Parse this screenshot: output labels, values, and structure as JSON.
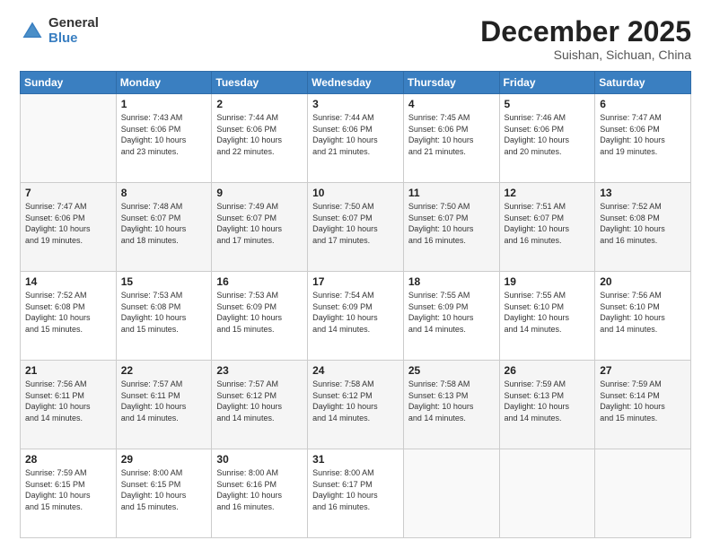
{
  "header": {
    "logo_general": "General",
    "logo_blue": "Blue",
    "month": "December 2025",
    "location": "Suishan, Sichuan, China"
  },
  "days_of_week": [
    "Sunday",
    "Monday",
    "Tuesday",
    "Wednesday",
    "Thursday",
    "Friday",
    "Saturday"
  ],
  "weeks": [
    [
      {
        "num": "",
        "info": ""
      },
      {
        "num": "1",
        "info": "Sunrise: 7:43 AM\nSunset: 6:06 PM\nDaylight: 10 hours\nand 23 minutes."
      },
      {
        "num": "2",
        "info": "Sunrise: 7:44 AM\nSunset: 6:06 PM\nDaylight: 10 hours\nand 22 minutes."
      },
      {
        "num": "3",
        "info": "Sunrise: 7:44 AM\nSunset: 6:06 PM\nDaylight: 10 hours\nand 21 minutes."
      },
      {
        "num": "4",
        "info": "Sunrise: 7:45 AM\nSunset: 6:06 PM\nDaylight: 10 hours\nand 21 minutes."
      },
      {
        "num": "5",
        "info": "Sunrise: 7:46 AM\nSunset: 6:06 PM\nDaylight: 10 hours\nand 20 minutes."
      },
      {
        "num": "6",
        "info": "Sunrise: 7:47 AM\nSunset: 6:06 PM\nDaylight: 10 hours\nand 19 minutes."
      }
    ],
    [
      {
        "num": "7",
        "info": "Sunrise: 7:47 AM\nSunset: 6:06 PM\nDaylight: 10 hours\nand 19 minutes."
      },
      {
        "num": "8",
        "info": "Sunrise: 7:48 AM\nSunset: 6:07 PM\nDaylight: 10 hours\nand 18 minutes."
      },
      {
        "num": "9",
        "info": "Sunrise: 7:49 AM\nSunset: 6:07 PM\nDaylight: 10 hours\nand 17 minutes."
      },
      {
        "num": "10",
        "info": "Sunrise: 7:50 AM\nSunset: 6:07 PM\nDaylight: 10 hours\nand 17 minutes."
      },
      {
        "num": "11",
        "info": "Sunrise: 7:50 AM\nSunset: 6:07 PM\nDaylight: 10 hours\nand 16 minutes."
      },
      {
        "num": "12",
        "info": "Sunrise: 7:51 AM\nSunset: 6:07 PM\nDaylight: 10 hours\nand 16 minutes."
      },
      {
        "num": "13",
        "info": "Sunrise: 7:52 AM\nSunset: 6:08 PM\nDaylight: 10 hours\nand 16 minutes."
      }
    ],
    [
      {
        "num": "14",
        "info": "Sunrise: 7:52 AM\nSunset: 6:08 PM\nDaylight: 10 hours\nand 15 minutes."
      },
      {
        "num": "15",
        "info": "Sunrise: 7:53 AM\nSunset: 6:08 PM\nDaylight: 10 hours\nand 15 minutes."
      },
      {
        "num": "16",
        "info": "Sunrise: 7:53 AM\nSunset: 6:09 PM\nDaylight: 10 hours\nand 15 minutes."
      },
      {
        "num": "17",
        "info": "Sunrise: 7:54 AM\nSunset: 6:09 PM\nDaylight: 10 hours\nand 14 minutes."
      },
      {
        "num": "18",
        "info": "Sunrise: 7:55 AM\nSunset: 6:09 PM\nDaylight: 10 hours\nand 14 minutes."
      },
      {
        "num": "19",
        "info": "Sunrise: 7:55 AM\nSunset: 6:10 PM\nDaylight: 10 hours\nand 14 minutes."
      },
      {
        "num": "20",
        "info": "Sunrise: 7:56 AM\nSunset: 6:10 PM\nDaylight: 10 hours\nand 14 minutes."
      }
    ],
    [
      {
        "num": "21",
        "info": "Sunrise: 7:56 AM\nSunset: 6:11 PM\nDaylight: 10 hours\nand 14 minutes."
      },
      {
        "num": "22",
        "info": "Sunrise: 7:57 AM\nSunset: 6:11 PM\nDaylight: 10 hours\nand 14 minutes."
      },
      {
        "num": "23",
        "info": "Sunrise: 7:57 AM\nSunset: 6:12 PM\nDaylight: 10 hours\nand 14 minutes."
      },
      {
        "num": "24",
        "info": "Sunrise: 7:58 AM\nSunset: 6:12 PM\nDaylight: 10 hours\nand 14 minutes."
      },
      {
        "num": "25",
        "info": "Sunrise: 7:58 AM\nSunset: 6:13 PM\nDaylight: 10 hours\nand 14 minutes."
      },
      {
        "num": "26",
        "info": "Sunrise: 7:59 AM\nSunset: 6:13 PM\nDaylight: 10 hours\nand 14 minutes."
      },
      {
        "num": "27",
        "info": "Sunrise: 7:59 AM\nSunset: 6:14 PM\nDaylight: 10 hours\nand 15 minutes."
      }
    ],
    [
      {
        "num": "28",
        "info": "Sunrise: 7:59 AM\nSunset: 6:15 PM\nDaylight: 10 hours\nand 15 minutes."
      },
      {
        "num": "29",
        "info": "Sunrise: 8:00 AM\nSunset: 6:15 PM\nDaylight: 10 hours\nand 15 minutes."
      },
      {
        "num": "30",
        "info": "Sunrise: 8:00 AM\nSunset: 6:16 PM\nDaylight: 10 hours\nand 16 minutes."
      },
      {
        "num": "31",
        "info": "Sunrise: 8:00 AM\nSunset: 6:17 PM\nDaylight: 10 hours\nand 16 minutes."
      },
      {
        "num": "",
        "info": ""
      },
      {
        "num": "",
        "info": ""
      },
      {
        "num": "",
        "info": ""
      }
    ]
  ]
}
